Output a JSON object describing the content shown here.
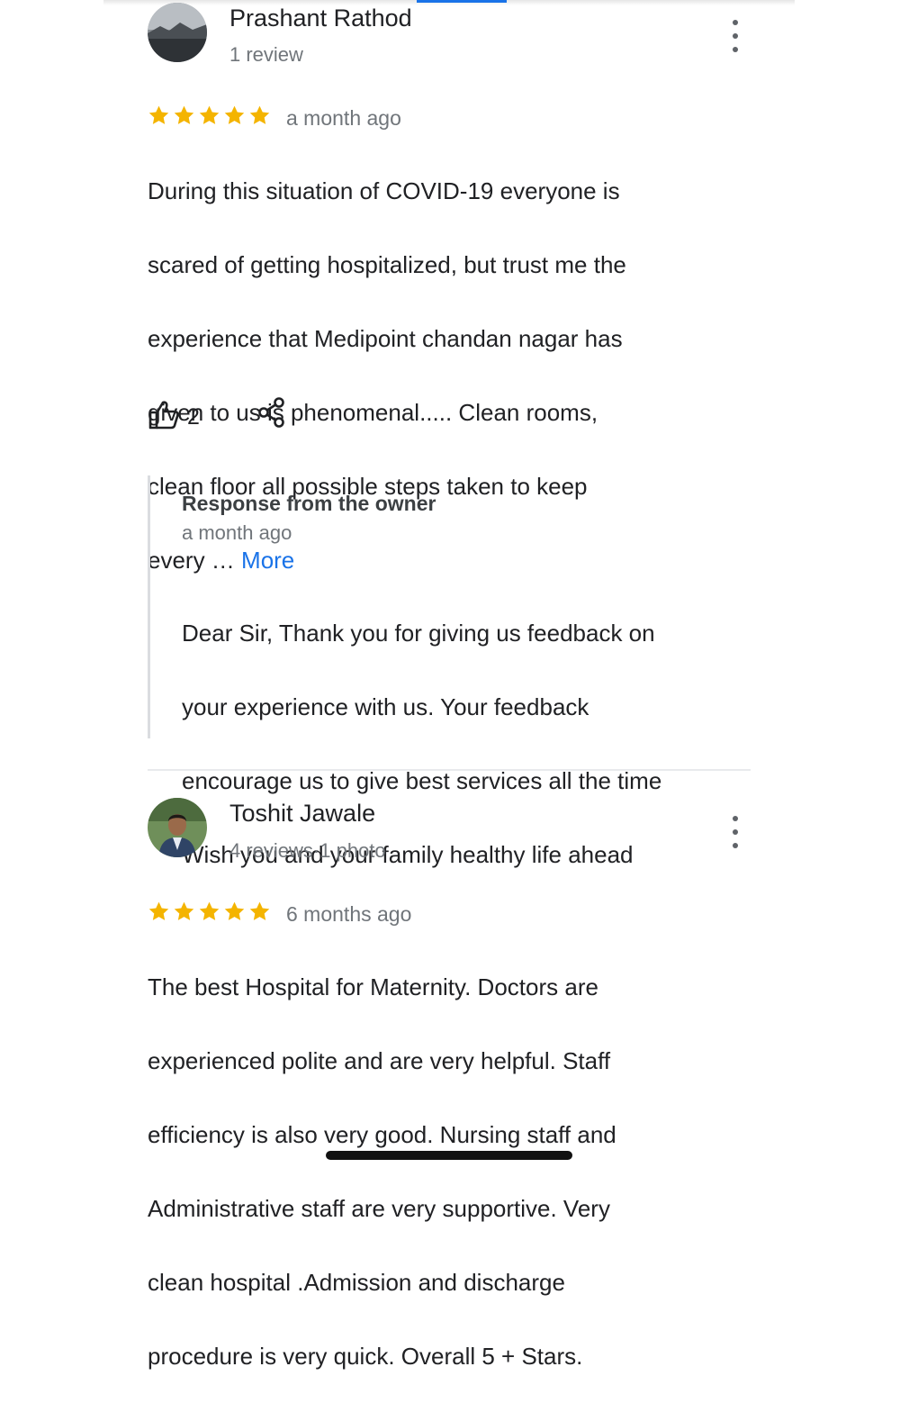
{
  "colors": {
    "star": "#f4b400",
    "link": "#1a73e8",
    "secondary_text": "#70757a"
  },
  "reviews": [
    {
      "author": "Prashant Rathod",
      "meta": "1 review",
      "rating": 5,
      "time": "a month ago",
      "text_line1": "During this situation of COVID-19 everyone is",
      "text_line2": "scared of getting hospitalized,  but trust me the",
      "text_line3": "experience that Medipoint chandan nagar has",
      "text_line4": "given to us is phenomenal..... Clean rooms,",
      "text_line5": "clean floor all possible steps taken to keep",
      "text_tail": "every … ",
      "more_label": "More",
      "likes": "2",
      "like_icon": "thumbs-up-icon",
      "share_icon": "share-icon",
      "menu_icon": "more-vert-icon",
      "owner_response": {
        "title": "Response from the owner",
        "time": "a month ago",
        "line1": "Dear Sir, Thank you for giving us feedback on",
        "line2": "your experience with us. Your feedback",
        "line3": "encourage us to give best services all the time",
        "line4": "Wish you and your family healthy life ahead"
      }
    },
    {
      "author": "Toshit Jawale",
      "meta": "4 reviews·1 photo",
      "rating": 5,
      "time": "6 months ago",
      "text_line1": "The best Hospital for Maternity. Doctors are",
      "text_line2": "experienced polite and are very helpful. Staff",
      "text_line3": "efficiency is also very good. Nursing staff and",
      "text_line4": "Administrative staff are very supportive. Very",
      "text_line5": "clean hospital .Admission and discharge",
      "text_line6": "procedure is very quick. Overall 5 + Stars.",
      "menu_icon": "more-vert-icon"
    }
  ]
}
